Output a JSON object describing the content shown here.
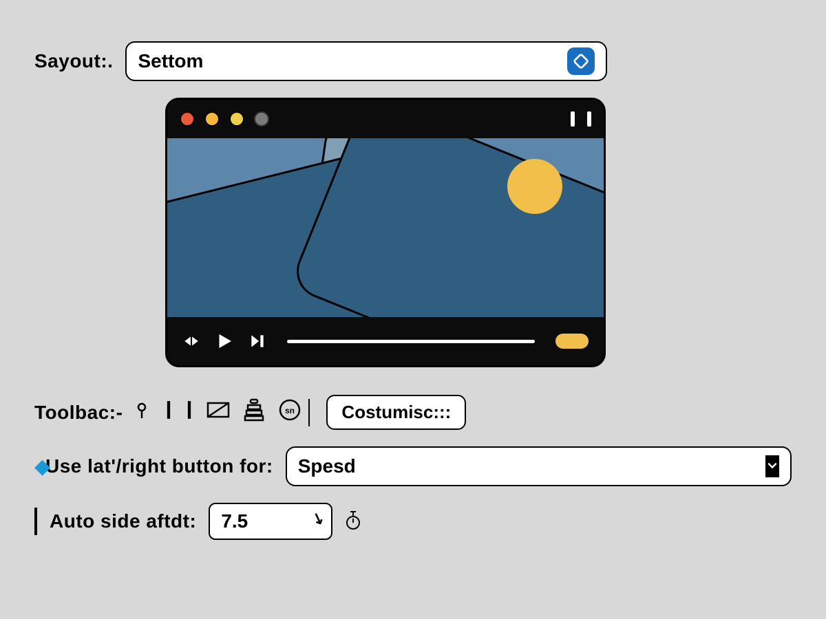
{
  "layout": {
    "label": "Sayout:.",
    "value": "Settom"
  },
  "player": {
    "traffic_lights": [
      "red",
      "orange",
      "yellow",
      "gray"
    ]
  },
  "toolbar": {
    "label": "Toolbac:-",
    "customize_label": "Costumisc:::"
  },
  "leftright": {
    "label": "Use lat'/right button for:",
    "value": "Spesd"
  },
  "autohide": {
    "label": "Auto side aftdt:",
    "value": "7.5"
  }
}
